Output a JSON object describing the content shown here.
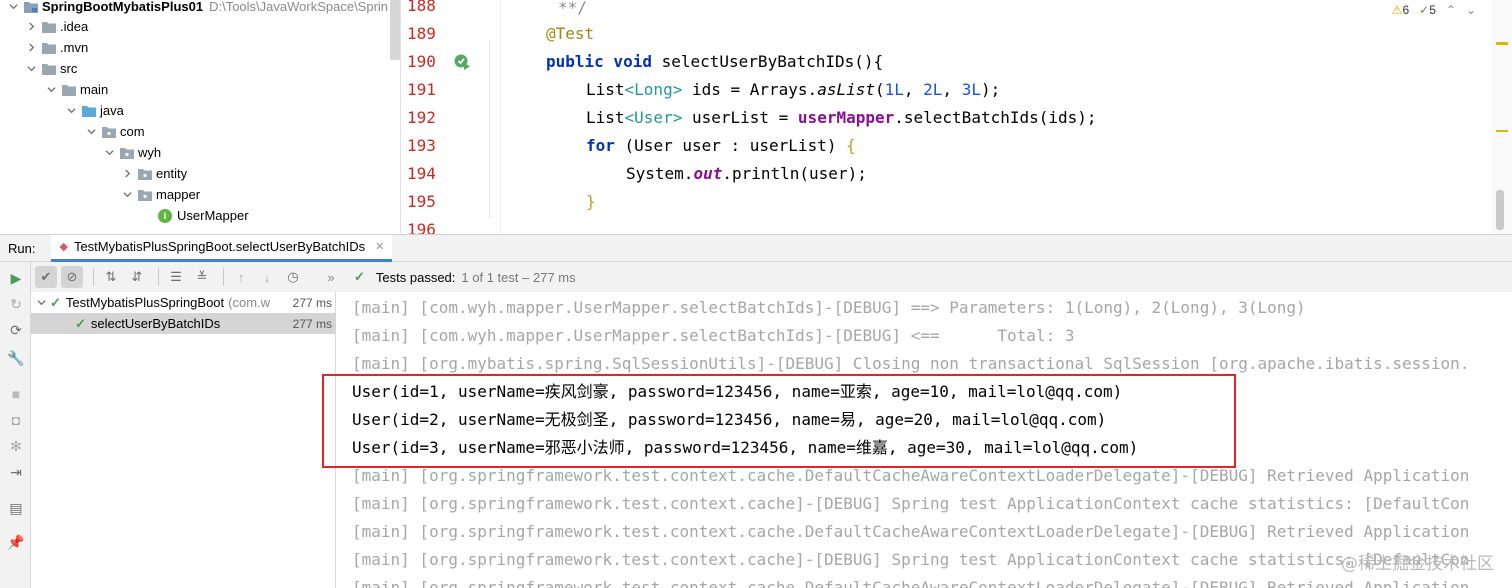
{
  "project": {
    "root_name": "SpringBootMybatisPlus01",
    "root_path": "D:\\Tools\\JavaWorkSpace\\Sprin",
    "items": [
      {
        "label": ".idea"
      },
      {
        "label": ".mvn"
      },
      {
        "label": "src"
      },
      {
        "label": "main"
      },
      {
        "label": "java"
      },
      {
        "label": "com"
      },
      {
        "label": "wyh"
      },
      {
        "label": "entity"
      },
      {
        "label": "mapper"
      },
      {
        "label": "UserMapper"
      }
    ]
  },
  "editor": {
    "line_numbers": [
      "188",
      "189",
      "190",
      "191",
      "192",
      "193",
      "194",
      "195",
      "196"
    ],
    "warnings": "6",
    "weak_warnings": "5",
    "code": {
      "l188": "**/",
      "l189": "@Test",
      "l190_kw": "public void",
      "l190_rest": " selectUserByBatchIDs(){",
      "l191_a": "List",
      "l191_g": "<Long>",
      "l191_b": " ids = Arrays.",
      "l191_m": "asList",
      "l191_c": "(",
      "l191_n1": "1L",
      "l191_n2": "2L",
      "l191_n3": "3L",
      "l191_d": ");",
      "l192_a": "List",
      "l192_g": "<User>",
      "l192_b": " userList = ",
      "l192_f": "userMapper",
      "l192_c": ".selectBatchIds(ids);",
      "l193_kw": "for",
      "l193_rest": " (User user : userList) ",
      "l193_br": "{",
      "l194_a": "System.",
      "l194_o": "out",
      "l194_b": ".println(user);",
      "l195": "}"
    }
  },
  "run": {
    "label": "Run:",
    "tab_title": "TestMybatisPlusSpringBoot.selectUserByBatchIDs",
    "status_text": "Tests passed:",
    "status_meta": "1 of 1 test – 277 ms"
  },
  "tests": {
    "suite": "TestMybatisPlusSpringBoot",
    "suite_extra": "(com.w",
    "suite_time": "277 ms",
    "test": "selectUserByBatchIDs",
    "test_time": "277 ms"
  },
  "console": {
    "lines": [
      "[main] [com.wyh.mapper.UserMapper.selectBatchIds]-[DEBUG] ==> Parameters: 1(Long), 2(Long), 3(Long)",
      "[main] [com.wyh.mapper.UserMapper.selectBatchIds]-[DEBUG] <==      Total: 3",
      "[main] [org.mybatis.spring.SqlSessionUtils]-[DEBUG] Closing non transactional SqlSession [org.apache.ibatis.session.",
      "User(id=1, userName=疾风剑豪, password=123456, name=亚索, age=10, mail=lol@qq.com)",
      "User(id=2, userName=无极剑圣, password=123456, name=易, age=20, mail=lol@qq.com)",
      "User(id=3, userName=邪恶小法师, password=123456, name=维嘉, age=30, mail=lol@qq.com)",
      "[main] [org.springframework.test.context.cache.DefaultCacheAwareContextLoaderDelegate]-[DEBUG] Retrieved Application",
      "[main] [org.springframework.test.context.cache]-[DEBUG] Spring test ApplicationContext cache statistics: [DefaultCon",
      "[main] [org.springframework.test.context.cache.DefaultCacheAwareContextLoaderDelegate]-[DEBUG] Retrieved Application",
      "[main] [org.springframework.test.context.cache]-[DEBUG] Spring test ApplicationContext cache statistics: [DefaultCon",
      "[main] [org.springframework.test.context.cache.DefaultCacheAwareContextLoaderDelegate]-[DEBUG] Retrieved Application"
    ]
  },
  "watermark": "@稀土掘金技术社区",
  "colors": {
    "highlight_border": "#e0262a",
    "line_number": "#d0281e",
    "pass_green": "#499c54"
  }
}
